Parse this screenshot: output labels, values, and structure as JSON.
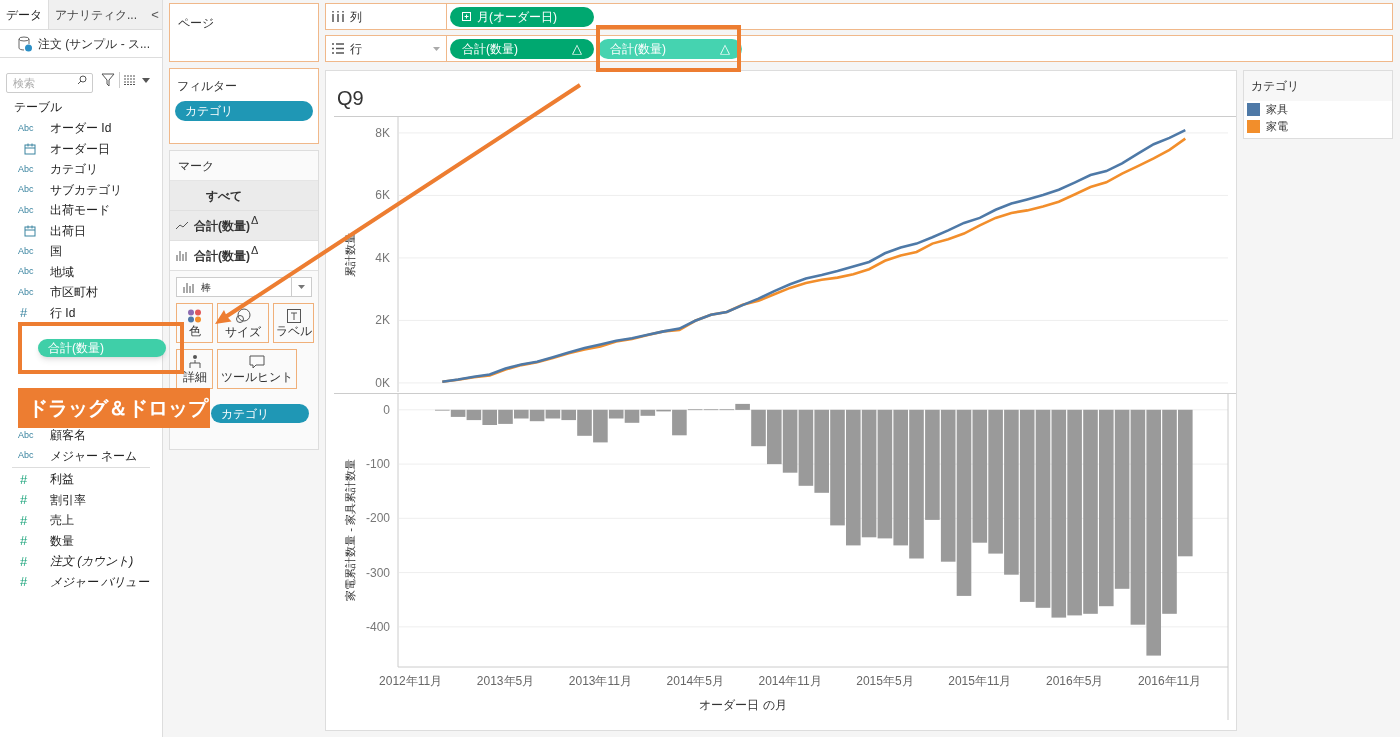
{
  "data_pane": {
    "tabs": [
      {
        "label": "データ",
        "selected": true
      },
      {
        "label": "アナリティク...",
        "selected": false
      }
    ],
    "collapse": "<",
    "data_source": "注文 (サンプル - ス...",
    "search": {
      "placeholder": "検索"
    },
    "section": "テーブル",
    "field_groups": [
      {
        "kind": "dimension",
        "fields": [
          {
            "label": "オーダー Id",
            "kind": "text",
            "badge": "Abc"
          },
          {
            "label": "オーダー日",
            "kind": "date"
          },
          {
            "label": "カテゴリ",
            "kind": "text",
            "badge": "Abc"
          },
          {
            "label": "サブカテゴリ",
            "kind": "text",
            "badge": "Abc"
          },
          {
            "label": "出荷モード",
            "kind": "text",
            "badge": "Abc"
          },
          {
            "label": "出荷日",
            "kind": "date"
          },
          {
            "label": "国",
            "kind": "text",
            "badge": "Abc"
          },
          {
            "label": "地域",
            "kind": "text",
            "badge": "Abc"
          },
          {
            "label": "市区町村",
            "kind": "text",
            "badge": "Abc"
          },
          {
            "label": "行 Id",
            "kind": "number",
            "badge": "#"
          }
        ]
      },
      {
        "kind": "dimension",
        "fields": [
          {
            "label": "顧客名",
            "kind": "text",
            "badge": "Abc"
          },
          {
            "label": "メジャー ネーム",
            "kind": "text",
            "badge": "Abc"
          }
        ]
      },
      {
        "kind": "measure",
        "fields": [
          {
            "label": "利益",
            "kind": "number",
            "badge": "#",
            "italic": false
          },
          {
            "label": "割引率",
            "kind": "number",
            "badge": "#",
            "italic": false
          },
          {
            "label": "売上",
            "kind": "number",
            "badge": "#",
            "italic": false
          },
          {
            "label": "数量",
            "kind": "number",
            "badge": "#",
            "italic": false
          },
          {
            "label": "注文 (カウント)",
            "kind": "number",
            "badge": "#",
            "italic": true
          },
          {
            "label": "メジャー バリュー",
            "kind": "number",
            "badge": "#",
            "italic": true
          }
        ]
      }
    ]
  },
  "pages": {
    "title": "ページ"
  },
  "filters": {
    "title": "フィルター",
    "pills": [
      {
        "label": "カテゴリ"
      }
    ]
  },
  "marks": {
    "title": "マーク",
    "cards": [
      {
        "kind": "all",
        "label": "すべて",
        "selected": false
      },
      {
        "kind": "line",
        "label": "合計(数量)",
        "delta": "Δ",
        "selected": false
      },
      {
        "kind": "bar",
        "label": "合計(数量)",
        "delta": "Δ",
        "selected": true
      }
    ],
    "mark_type": "棒",
    "buttons": [
      {
        "kind": "color",
        "label": "色"
      },
      {
        "kind": "size",
        "label": "サイズ"
      },
      {
        "kind": "label",
        "label": "ラベル"
      },
      {
        "kind": "detail",
        "label": "詳細"
      },
      {
        "kind": "tooltip",
        "label": "ツールヒント"
      }
    ],
    "pills": [
      {
        "label": "カテゴリ"
      }
    ]
  },
  "columns_shelf": {
    "label": "列",
    "pills": [
      {
        "label": "月(オーダー日)",
        "kind": "date"
      }
    ]
  },
  "rows_shelf": {
    "label": "行",
    "pills": [
      {
        "label": "合計(数量)",
        "delta": "△",
        "highlighted": false
      },
      {
        "label": "合計(数量)",
        "delta": "△",
        "highlighted": true
      }
    ]
  },
  "view": {
    "title": "Q9",
    "line_chart": {
      "chart_data": {
        "type": "line",
        "ylabel": "累計数量",
        "categories": [
          null,
          null,
          null,
          null,
          null,
          null,
          null,
          null,
          null,
          null,
          null,
          null,
          null,
          null,
          null,
          null,
          null,
          null,
          null,
          null,
          null,
          null,
          null,
          null,
          null,
          null,
          null,
          null,
          null,
          null,
          null,
          null,
          null,
          null,
          null,
          null,
          null,
          null,
          null,
          null,
          null,
          null,
          null,
          null,
          null,
          null,
          null,
          null,
          null,
          null
        ],
        "ylim": [
          -290,
          8510
        ],
        "yticks": [
          {
            "value": 0,
            "label": "0K"
          },
          {
            "value": 2000,
            "label": "2K"
          },
          {
            "value": 4000,
            "label": "4K"
          },
          {
            "value": 6000,
            "label": "6K"
          },
          {
            "value": 8000,
            "label": "8K"
          }
        ],
        "grid": true,
        "series": [
          {
            "name": "家具",
            "color": "#4e79a7",
            "values": [
              null,
              null,
              40,
              110,
              200,
              270,
              460,
              590,
              680,
              820,
              970,
              1120,
              1230,
              1350,
              1430,
              1540,
              1650,
              1740,
              1990,
              2180,
              2270,
              2490,
              2700,
              2940,
              3160,
              3340,
              3450,
              3580,
              3730,
              3870,
              4150,
              4330,
              4460,
              4660,
              4880,
              5120,
              5280,
              5540,
              5740,
              5870,
              6010,
              6180,
              6410,
              6650,
              6780,
              7030,
              7340,
              7640,
              7840,
              8090
            ]
          },
          {
            "name": "家電",
            "color": "#f28e2b",
            "values": [
              null,
              null,
              40,
              100,
              180,
              240,
              430,
              570,
              660,
              800,
              950,
              1070,
              1170,
              1330,
              1410,
              1530,
              1650,
              1690,
              1990,
              2180,
              2270,
              2500,
              2630,
              2840,
              3040,
              3200,
              3300,
              3370,
              3480,
              3640,
              3910,
              4080,
              4190,
              4460,
              4600,
              4780,
              5040,
              5280,
              5440,
              5520,
              5650,
              5800,
              6030,
              6270,
              6420,
              6700,
              6940,
              7190,
              7460,
              7820
            ]
          }
        ]
      }
    },
    "bar_chart": {
      "chart_data": {
        "type": "bar",
        "xlabel": "オーダー日 の月",
        "ylabel": "家電累計数量 - 家具累計数量",
        "categories": [
          "2012年11月",
          null,
          null,
          null,
          null,
          null,
          "2013年5月",
          null,
          null,
          null,
          null,
          null,
          "2013年11月",
          null,
          null,
          null,
          null,
          null,
          "2014年5月",
          null,
          null,
          null,
          null,
          null,
          "2014年11月",
          null,
          null,
          null,
          null,
          null,
          "2015年5月",
          null,
          null,
          null,
          null,
          null,
          "2015年11月",
          null,
          null,
          null,
          null,
          null,
          "2016年5月",
          null,
          null,
          null,
          null,
          null,
          "2016年11月",
          null
        ],
        "ylim": [
          -474,
          31
        ],
        "yticks": [
          0,
          -100,
          -200,
          -300,
          -400
        ],
        "grid": true,
        "values": [
          null,
          null,
          -1,
          -13,
          -19,
          -28,
          -26,
          -16,
          -21,
          -16,
          -19,
          -48,
          -60,
          -16,
          -24,
          -11,
          -3,
          -47,
          1,
          1,
          1,
          11,
          -67,
          -100,
          -116,
          -140,
          -153,
          -213,
          -250,
          -235,
          -237,
          -250,
          -274,
          -203,
          -280,
          -343,
          -245,
          -265,
          -304,
          -354,
          -365,
          -383,
          -379,
          -376,
          -362,
          -330,
          -396,
          -453,
          -376,
          -270
        ],
        "color": "#9a9a9a"
      }
    }
  },
  "legend": {
    "title": "カテゴリ"
  },
  "annotation": {
    "label": "ドラッグ＆ドロップ",
    "drag_pill": "合計(数量)"
  }
}
